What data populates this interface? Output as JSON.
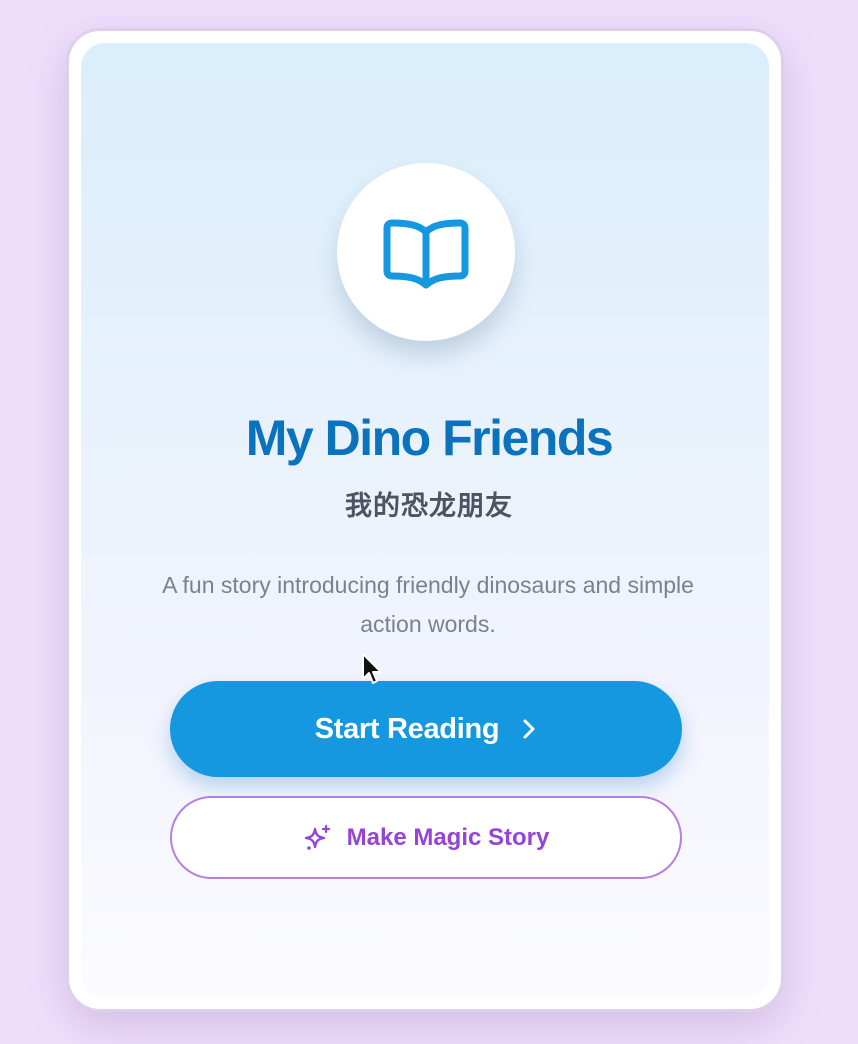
{
  "story": {
    "title": "My Dino Friends",
    "subtitle": "我的恐龙朋友",
    "description": "A fun story introducing friendly dinosaurs and simple action words.",
    "icon": "open-book-icon"
  },
  "actions": {
    "start_label": "Start Reading",
    "start_icon": "chevron-right-icon",
    "magic_label": "Make Magic Story",
    "magic_icon": "sparkle-icon"
  },
  "colors": {
    "background": "#efdefb",
    "primary": "#1598e0",
    "title": "#0b72bd",
    "magic": "#9544d6",
    "magic_border": "#b67fe0"
  }
}
